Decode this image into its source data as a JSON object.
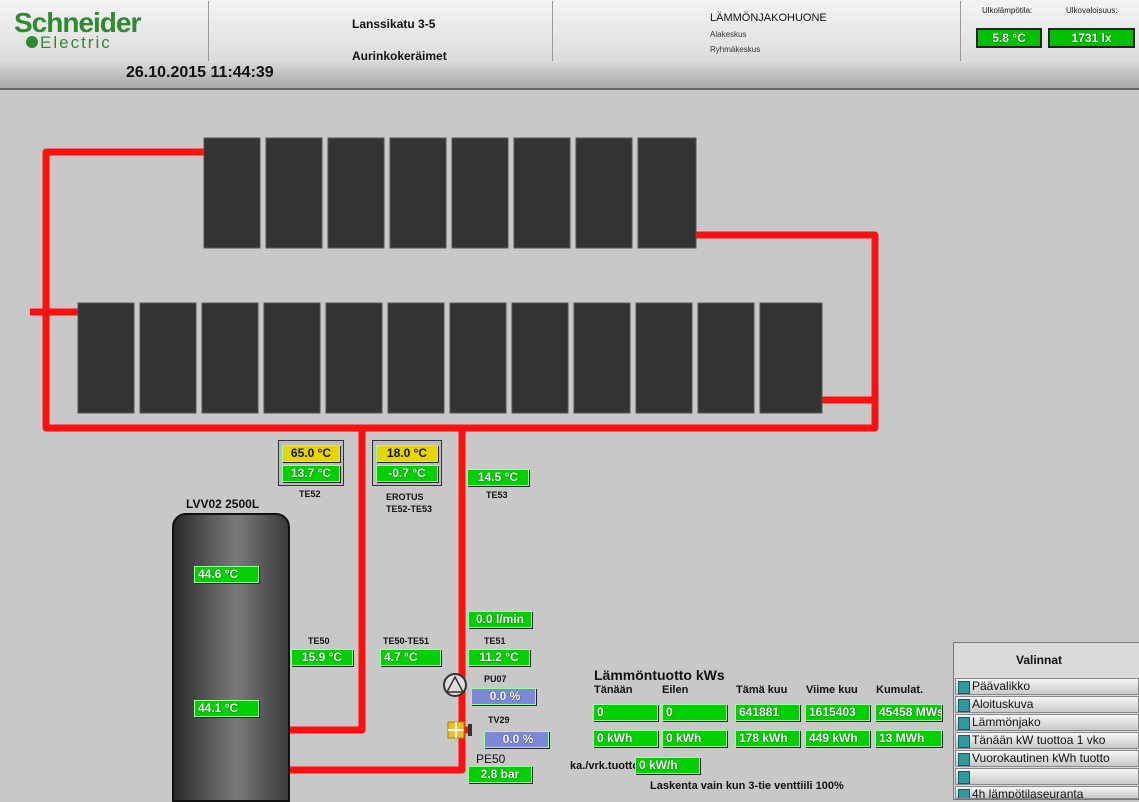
{
  "header": {
    "logo_main": "Schneider",
    "logo_sub": "Electric",
    "site": "Lanssikatu 3-5",
    "page_title": "Aurinkokeräimet",
    "room": "LÄMMÖNJAKOHUONE",
    "sub1": "Alakeskus",
    "sub2": "Ryhmäkeskus",
    "outdoor_temp_label": "Ulkolämpötila:",
    "outdoor_temp": "5.8 °C",
    "outdoor_lux_label": "Ulkovaloisuus:",
    "outdoor_lux": "1731 lx"
  },
  "datetime": "26.10.2015 11:44:39",
  "colors": {
    "pipe": "#ff1010",
    "value_green": "#00d000",
    "value_yellow": "#e6d600",
    "value_blue": "#7b88d8",
    "menu_square": "#2f9aa0"
  },
  "sensors": {
    "te52_set": "65.0 °C",
    "te52": "13.7 °C",
    "te52_label": "TE52",
    "erotus_set": "18.0 °C",
    "erotus": "-0.7 °C",
    "erotus_label_1": "EROTUS",
    "erotus_label_2": "TE52-TE53",
    "te53": "14.5 °C",
    "te53_label": "TE53",
    "tank_label": "LVV02  2500L",
    "tank_top": "44.6 °C",
    "tank_bottom": "44.1 °C",
    "te50_label": "TE50",
    "te50": "15.9 °C",
    "te50_te51_label": "TE50-TE51",
    "te50_te51": "4.7 °C",
    "te51_label": "TE51",
    "te51": "11.2 °C",
    "flow": "0.0 l/min",
    "pu07_label": "PU07",
    "pu07": "0.0 %",
    "tv29_label": "TV29",
    "tv29": "0.0 %",
    "pe50_label": "PE50",
    "pe50": "2.8 bar"
  },
  "energy": {
    "title": "Lämmöntuotto kWs",
    "headers": [
      "Tänään",
      "Eilen",
      "Tämä kuu",
      "Viime kuu",
      "Kumulat."
    ],
    "kws": [
      "0",
      "0",
      "641881",
      "1615403",
      "45458 MWs"
    ],
    "kwh": [
      "0 kWh",
      "0 kWh",
      "178 kWh",
      "449 kWh",
      "13 MWh"
    ],
    "avg_label": "ka./vrk.tuotto",
    "avg_value": "0 kW/h",
    "note": "Laskenta vain kun 3-tie venttiili 100%"
  },
  "menu": {
    "title": "Valinnat",
    "items": [
      "Päävalikko",
      "Aloituskuva",
      "Lämmönjako",
      "Tänään kW tuottoa 1 vko",
      "Vuorokautinen kWh tuotto",
      "",
      "4h lämpötilaseuranta"
    ]
  }
}
